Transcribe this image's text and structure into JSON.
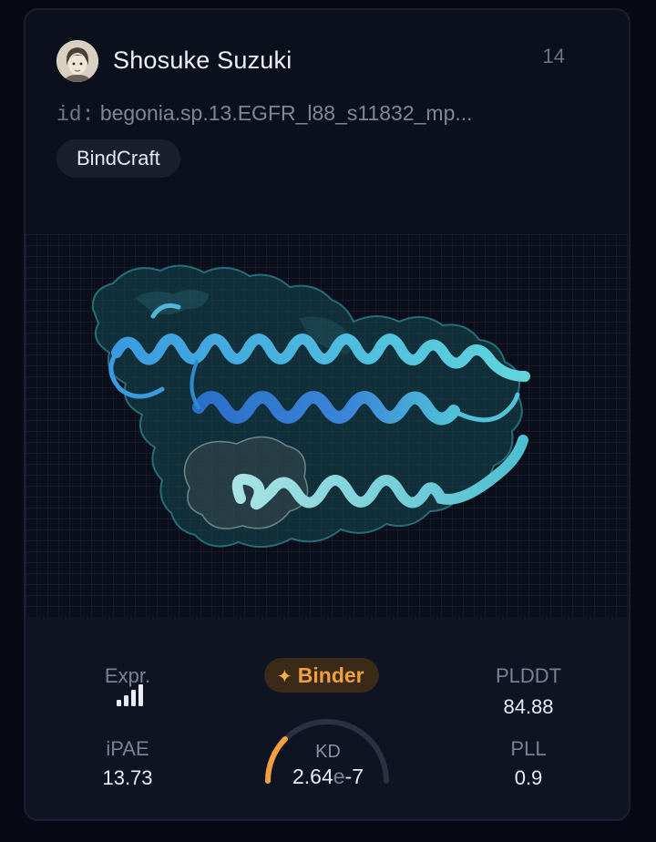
{
  "card": {
    "author": "Shosuke Suzuki",
    "count": "14",
    "id_label": "id:",
    "id_value": "begonia.sp.13.EGFR_l88_s11832_mp...",
    "tag": "BindCraft"
  },
  "stats": {
    "expr_label": "Expr.",
    "expr_level": 3,
    "ipae_label": "iPAE",
    "ipae_value": "13.73",
    "badge_label": "Binder",
    "kd_label": "KD",
    "kd_mantissa": "2.64",
    "kd_e": "e",
    "kd_exponent": "-7",
    "kd_gauge_fraction": 0.25,
    "plddt_label": "PLDDT",
    "plddt_value": "84.88",
    "pll_label": "PLL",
    "pll_value": "0.9"
  },
  "colors": {
    "accent_orange": "#f0a040",
    "helix_cyan": "#4fc8d8",
    "helix_blue": "#2f7fd0"
  },
  "icons": {
    "avatar": "avatar-illustration",
    "expr": "signal-bars-icon",
    "badge": "sparkle-icon"
  }
}
